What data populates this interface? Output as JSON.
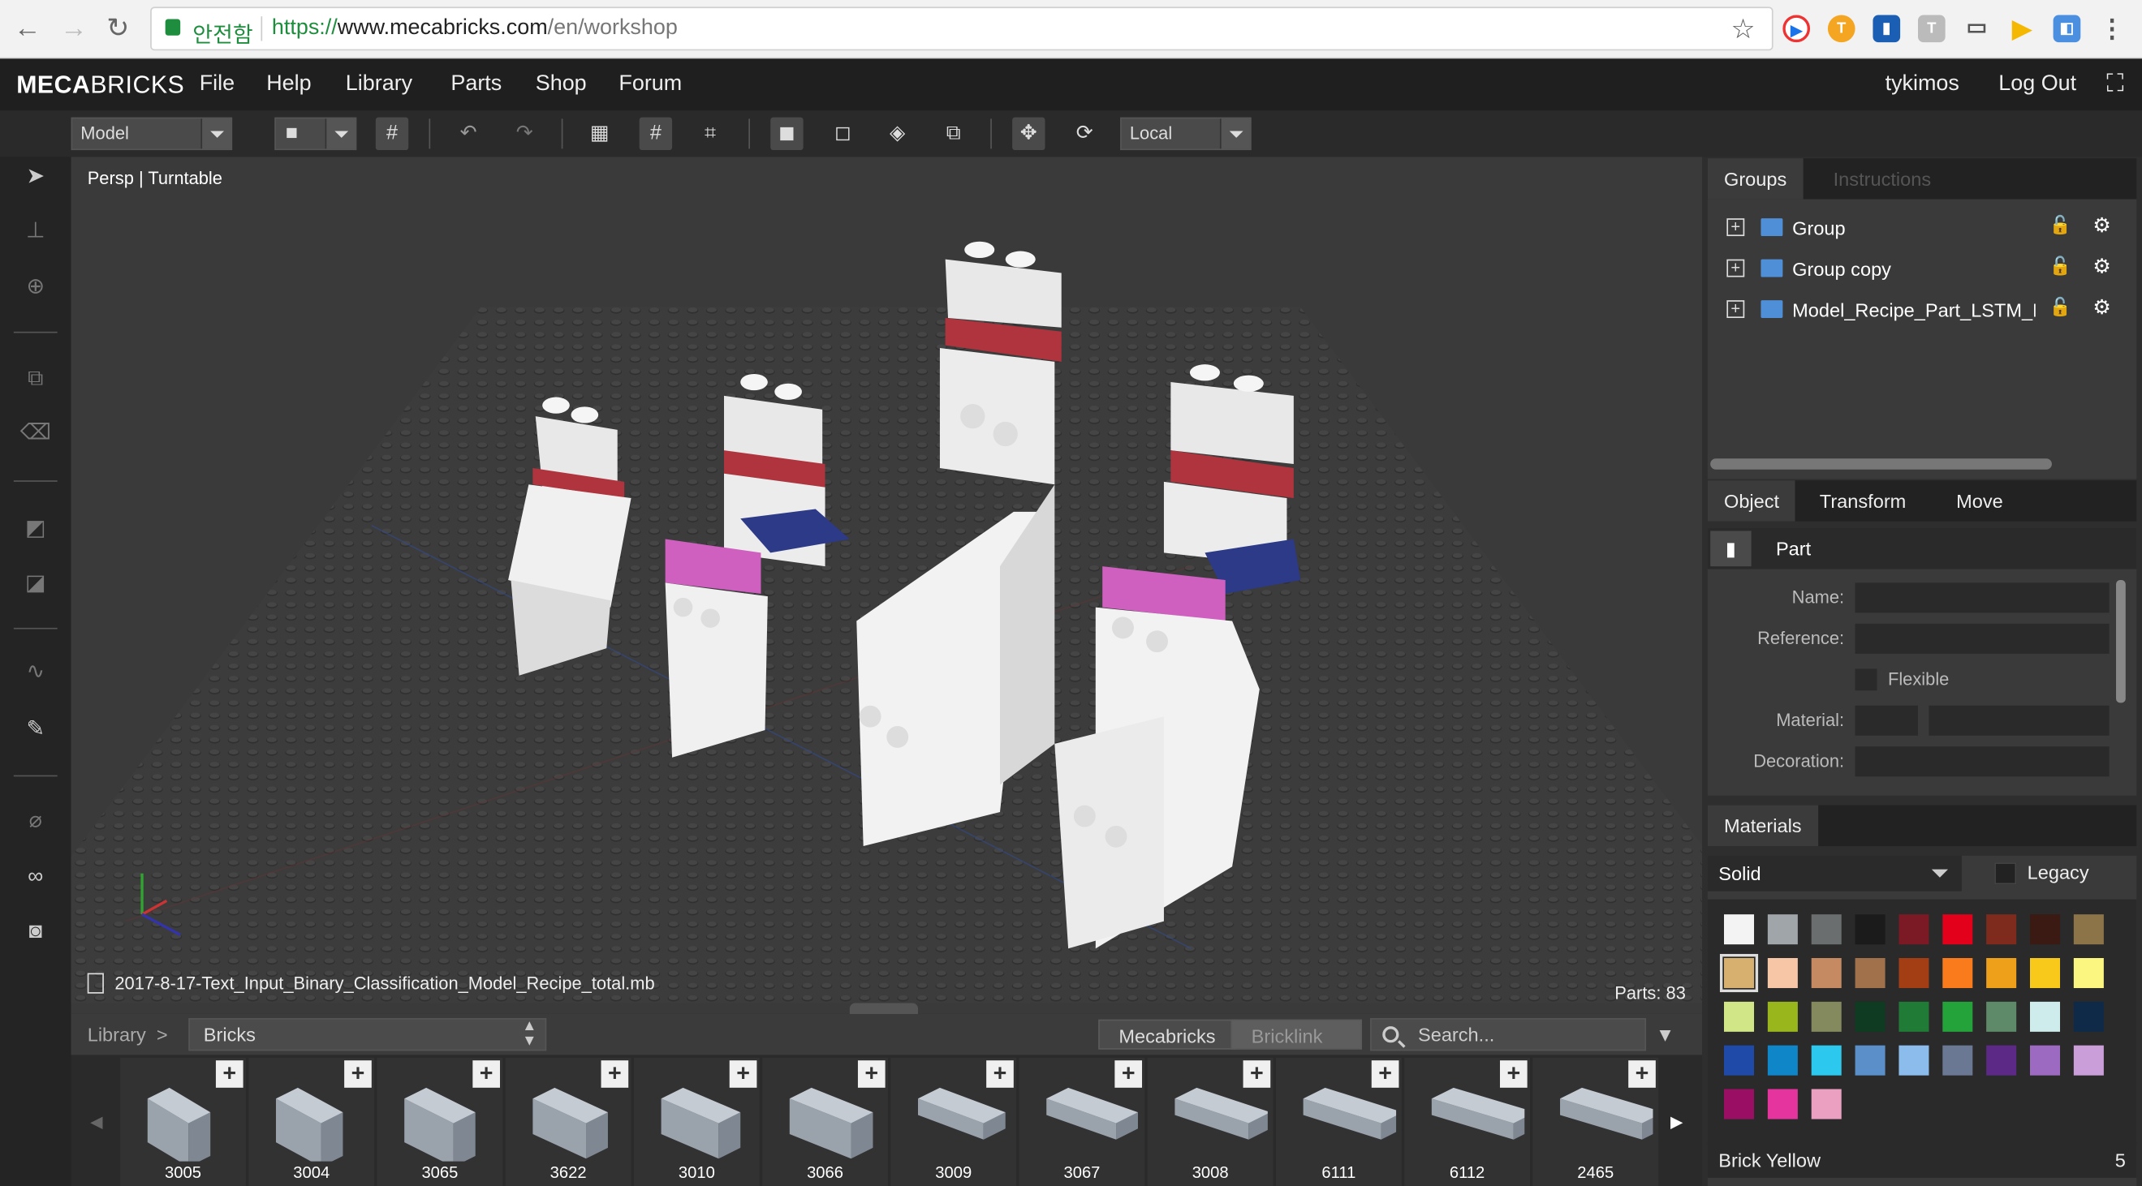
{
  "browser": {
    "security_label": "안전함",
    "url_scheme": "https://",
    "url_host": "www.mecabricks.com",
    "url_path": "/en/workshop"
  },
  "menubar": {
    "logo_bold": "MECA",
    "logo_rest": "BRICKS",
    "items": [
      "File",
      "Help",
      "Library",
      "Parts",
      "Shop",
      "Forum"
    ],
    "username": "tykimos",
    "logout": "Log Out"
  },
  "toolbar": {
    "mode_value": "Model",
    "space_value": "Local"
  },
  "viewport": {
    "camera_label": "Persp | Turntable",
    "filename": "2017-8-17-Text_Input_Binary_Classification_Model_Recipe_total.mb",
    "parts_count": "Parts: 83"
  },
  "library": {
    "crumb": "Library",
    "category": "Bricks",
    "source_tabs": [
      "Mecabricks",
      "Bricklink"
    ],
    "search_placeholder": "Search...",
    "parts": [
      "3005",
      "3004",
      "3065",
      "3622",
      "3010",
      "3066",
      "3009",
      "3067",
      "3008",
      "6111",
      "6112",
      "2465"
    ]
  },
  "right_panel": {
    "group_tabs": [
      "Groups",
      "Instructions"
    ],
    "groups": [
      "Group",
      "Group copy",
      "Model_Recipe_Part_LSTM_Exa"
    ],
    "object_tabs": [
      "Object",
      "Transform",
      "Move"
    ],
    "object_type": "Part",
    "fields": {
      "name": "Name:",
      "reference": "Reference:",
      "flexible": "Flexible",
      "material": "Material:",
      "decoration": "Decoration:"
    },
    "materials_tab": "Materials",
    "material_type": "Solid",
    "legacy_label": "Legacy",
    "selected_material": "Brick Yellow",
    "selected_material_count": "5",
    "swatch_colors": [
      "#f2f3f2",
      "#a0a5a9",
      "#6b6e6f",
      "#1b1b1b",
      "#7b1a24",
      "#e3001a",
      "#7e2a1c",
      "#3a1a12",
      "#8c7448",
      "#d7b06f",
      "#f6c6a6",
      "#c58a61",
      "#a0714a",
      "#a33d14",
      "#f97b1c",
      "#eea01a",
      "#f8c91a",
      "#faf680",
      "#d1e686",
      "#99b71c",
      "#848a5e",
      "#0f3b22",
      "#1f7b36",
      "#23a33a",
      "#5f8a6a",
      "#cdeceb",
      "#0f2a49",
      "#1f4aa8",
      "#0f86c8",
      "#2cc8ee",
      "#5a8fc9",
      "#8cbcec",
      "#6a7894",
      "#5c2a86",
      "#9c6ac0",
      "#ca9ed8",
      "#9a0f64",
      "#e6349e",
      "#eba0c2"
    ]
  }
}
